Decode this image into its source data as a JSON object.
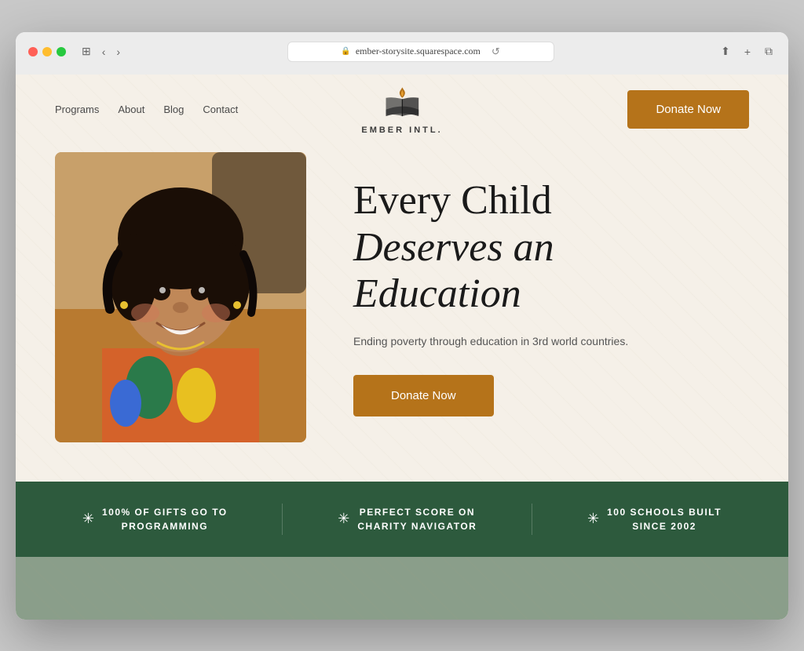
{
  "browser": {
    "url": "ember-storysite.squarespace.com",
    "reload_label": "↺"
  },
  "nav": {
    "programs_label": "Programs",
    "about_label": "About",
    "blog_label": "Blog",
    "contact_label": "Contact"
  },
  "logo": {
    "name": "EMBER INTL."
  },
  "header": {
    "donate_label": "Donate Now"
  },
  "hero": {
    "title_line1": "Every Child",
    "title_line2": "Deserves an",
    "title_line3": "Education",
    "subtitle": "Ending poverty through education in 3rd world countries.",
    "donate_label": "Donate Now"
  },
  "stats": {
    "items": [
      {
        "icon": "✳",
        "text": "100% OF GIFTS GO TO\nPROGRAMMING"
      },
      {
        "icon": "✳",
        "text": "PERFECT SCORE ON\nCHARITY NAVIGATOR"
      },
      {
        "icon": "✳",
        "text": "100 SCHOOLS BUILT\nSINCE 2002"
      }
    ]
  },
  "colors": {
    "donate_bg": "#b5731a",
    "stats_bg": "#2d5a3d",
    "site_bg": "#f5f0e8"
  }
}
